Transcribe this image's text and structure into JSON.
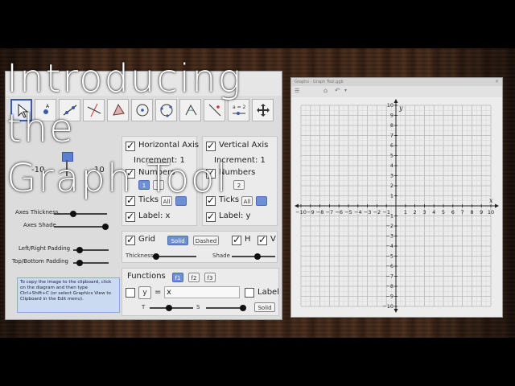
{
  "overlay": {
    "line1": "Introducing",
    "line2": "the",
    "line3": "Graph Tool"
  },
  "axes_panel": {
    "horizontal": {
      "label": "Horizontal Axis",
      "increment": "Increment: 1",
      "numbers": "Numbers",
      "btn1": "1",
      "btn2": "2",
      "ticks": "Ticks",
      "ticks_all": "All",
      "axis_label": "Label: x"
    },
    "vertical": {
      "label": "Vertical Axis",
      "increment": "Increment: 1",
      "numbers": "Numbers",
      "btn2": "2",
      "ticks": "Ticks",
      "ticks_all": "All",
      "axis_label": "Label: y"
    }
  },
  "range": {
    "min": "-10",
    "max": "10"
  },
  "left_labels": {
    "axes_thickness": "Axes Thickness",
    "axes_shade": "Axes Shade",
    "lr_padding": "Left/Right Padding",
    "tb_padding": "Top/Bottom Padding"
  },
  "grid_panel": {
    "grid": "Grid",
    "solid": "Solid",
    "dashed": "Dashed",
    "h": "H",
    "v": "V",
    "thickness": "Thickness",
    "shade": "Shade"
  },
  "functions_panel": {
    "title": "Functions",
    "f1": "f1",
    "f2": "f2",
    "f3": "f3",
    "y": "y",
    "equals": "=",
    "value": "x",
    "label": "Label",
    "t": "T",
    "s": "S",
    "solid": "Solid"
  },
  "help": {
    "text": "To copy the image to the clipboard, click on the diagram and then type Ctrl+Shift+C (or select Graphics View to Clipboard in the Edit menu)."
  },
  "graph_window": {
    "title": "Graphs - Graph Tool.ggb",
    "x_label": "x",
    "y_label": "y"
  },
  "chart_data": {
    "type": "scatter",
    "xlim": [
      -10,
      10
    ],
    "ylim": [
      -10,
      10
    ],
    "x_ticks": [
      -10,
      -9,
      -8,
      -7,
      -6,
      -5,
      -4,
      -3,
      -2,
      -1,
      1,
      2,
      3,
      4,
      5,
      6,
      7,
      8,
      9,
      10
    ],
    "y_ticks": [
      -10,
      -9,
      -8,
      -7,
      -6,
      -5,
      -4,
      -3,
      -2,
      -1,
      1,
      2,
      3,
      4,
      5,
      6,
      7,
      8,
      9,
      10
    ],
    "xlabel": "x",
    "ylabel": "y",
    "grid": true
  }
}
